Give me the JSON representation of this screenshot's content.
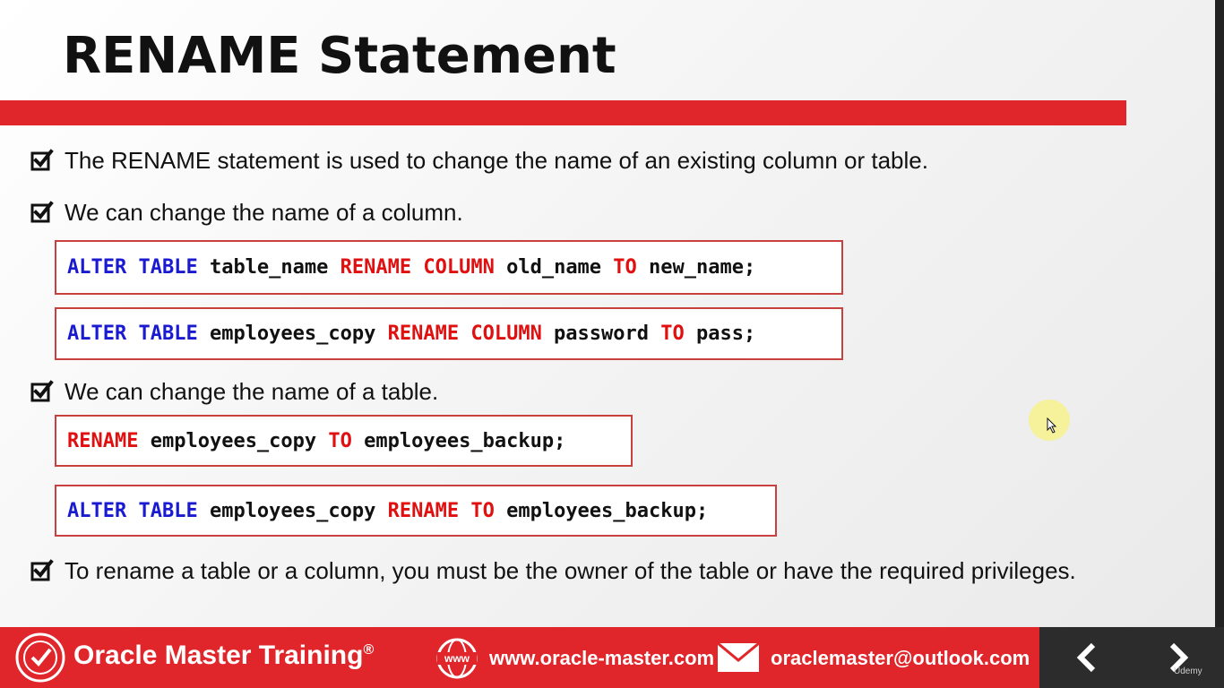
{
  "slide": {
    "title": "RENAME Statement"
  },
  "bullets": [
    "The RENAME statement is used to change the name of an existing column or table.",
    "We can change the name of a column.",
    "We can change the name of a table.",
    "To rename a table or a column, you must be the owner of the table or have the required privileges."
  ],
  "code": {
    "c1": {
      "kw1": "ALTER TABLE",
      "t1": " table_name ",
      "kw2": "RENAME COLUMN",
      "t2": " old_name ",
      "kw3": "TO",
      "t3": " new_name;"
    },
    "c2": {
      "kw1": "ALTER TABLE",
      "t1": " employees_copy ",
      "kw2": "RENAME COLUMN",
      "t2": " password ",
      "kw3": "TO",
      "t3": " pass;"
    },
    "c3": {
      "kw1": "RENAME",
      "t1": " employees_copy ",
      "kw2": "TO",
      "t2": " employees_backup;"
    },
    "c4": {
      "kw1": "ALTER TABLE",
      "t1": " employees_copy ",
      "kw2": "RENAME TO",
      "t2": " employees_backup;"
    }
  },
  "footer": {
    "brand": "Oracle Master Training",
    "reg": "®",
    "website": "www.oracle-master.com",
    "email": "oraclemaster@outlook.com",
    "udemy": "Udemy",
    "www_label": "www"
  },
  "icons": {
    "bullet": "checkbox-checked-icon",
    "pointer": "mouse-pointer-icon",
    "prev": "chevron-left-icon",
    "next": "chevron-right-icon",
    "globe": "globe-www-icon",
    "mail": "envelope-icon",
    "badge": "certified-badge-icon"
  },
  "colors": {
    "accent_red": "#e0262a",
    "keyword_blue": "#1a1ad0",
    "keyword_red": "#e01010",
    "code_border": "#c8413f",
    "footer_dark": "#2c2c2c"
  }
}
